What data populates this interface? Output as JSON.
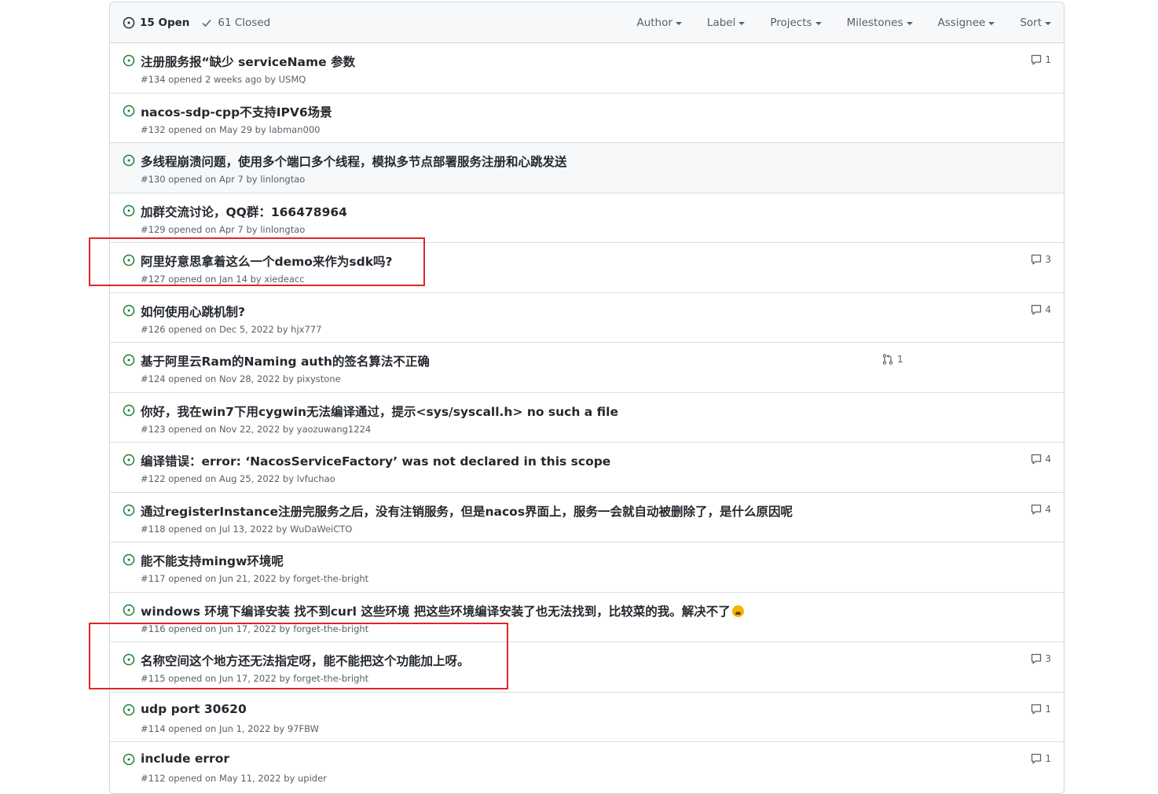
{
  "header": {
    "open_label": "15 Open",
    "closed_label": "61 Closed",
    "filters": [
      "Author",
      "Label",
      "Projects",
      "Milestones",
      "Assignee",
      "Sort"
    ]
  },
  "issues": [
    {
      "title": "注册服务报“缺少 serviceName 参数",
      "meta": "#134 opened 2 weeks ago by USMQ",
      "comments": "1"
    },
    {
      "title": "nacos-sdp-cpp不支持IPV6场景",
      "meta": "#132 opened on May 29 by labman000",
      "comments": ""
    },
    {
      "title": "多线程崩溃问题，使用多个端口多个线程，模拟多节点部署服务注册和心跳发送",
      "meta": "#130 opened on Apr 7 by linlongtao",
      "comments": ""
    },
    {
      "title": "加群交流讨论，QQ群：166478964",
      "meta": "#129 opened on Apr 7 by linlongtao",
      "comments": ""
    },
    {
      "title": "阿里好意思拿着这么一个demo来作为sdk吗?",
      "meta": "#127 opened on Jan 14 by xiedeacc",
      "comments": "3"
    },
    {
      "title": "如何使用心跳机制?",
      "meta": "#126 opened on Dec 5, 2022 by hjx777",
      "comments": "4"
    },
    {
      "title": "基于阿里云Ram的Naming auth的签名算法不正确",
      "meta": "#124 opened on Nov 28, 2022 by pixystone",
      "comments": "",
      "linked_pr": "1"
    },
    {
      "title": "你好，我在win7下用cygwin无法编译通过，提示<sys/syscall.h> no such a file",
      "meta": "#123 opened on Nov 22, 2022 by yaozuwang1224",
      "comments": ""
    },
    {
      "title": "编译错误：error: ‘NacosServiceFactory’ was not declared in this scope",
      "meta": "#122 opened on Aug 25, 2022 by lvfuchao",
      "comments": "4"
    },
    {
      "title": "通过registerInstance注册完服务之后，没有注销服务，但是nacos界面上，服务一会就自动被删除了，是什么原因呢",
      "meta": "#118 opened on Jul 13, 2022 by WuDaWeiCTO",
      "comments": "4"
    },
    {
      "title": "能不能支持mingw环境呢",
      "meta": "#117 opened on Jun 21, 2022 by forget-the-bright",
      "comments": ""
    },
    {
      "title": "windows 环境下编译安装 找不到curl 这些环境 把这些环境编译安装了也无法找到，比较菜的我。解决不了",
      "meta": "#116 opened on Jun 17, 2022 by forget-the-bright",
      "comments": "",
      "emoji": "crying-face"
    },
    {
      "title": "名称空间这个地方还无法指定呀，能不能把这个功能加上呀。",
      "meta": "#115 opened on Jun 17, 2022 by forget-the-bright",
      "comments": "3"
    },
    {
      "title": "udp port 30620",
      "meta": "#114 opened on Jun 1, 2022 by 97FBW",
      "comments": "1"
    },
    {
      "title": "include error",
      "meta": "#112 opened on May 11, 2022 by upider",
      "comments": "1"
    }
  ],
  "colors": {
    "open_green": "#1a7f37",
    "highlight_red": "#e0262a",
    "muted": "#57606a"
  },
  "annotations": {
    "highlighted_issues": [
      "#127",
      "#115"
    ]
  }
}
